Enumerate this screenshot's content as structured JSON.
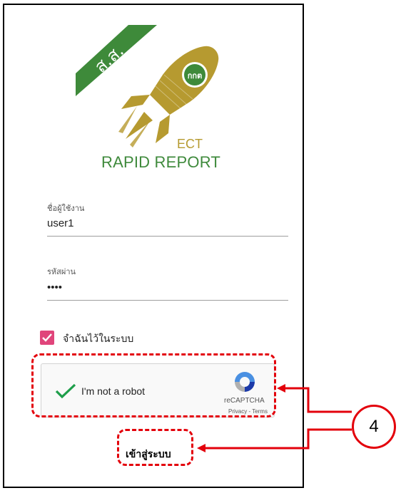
{
  "app": {
    "ribbon_text": "ส.ส.",
    "badge_text": "กกต",
    "ect_label": "ECT",
    "title": "RAPID REPORT"
  },
  "form": {
    "username_label": "ชื่อผู้ใช้งาน",
    "username_value": "user1",
    "password_label": "รหัสผ่าน",
    "password_value": "••••",
    "remember_label": "จำฉันไว้ในระบบ",
    "remember_checked": true
  },
  "captcha": {
    "label": "I'm not a robot",
    "brand": "reCAPTCHA",
    "links": "Privacy - Terms",
    "checked": true
  },
  "login_button": "เข้าสู่ระบบ",
  "annotation": {
    "callout_number": "4",
    "color": "#e3000b"
  },
  "colors": {
    "ribbon": "#3e8a3a",
    "rocket_gold": "#b69a30",
    "checkbox_pink": "#e0457b",
    "captcha_green": "#1e9e4a"
  }
}
